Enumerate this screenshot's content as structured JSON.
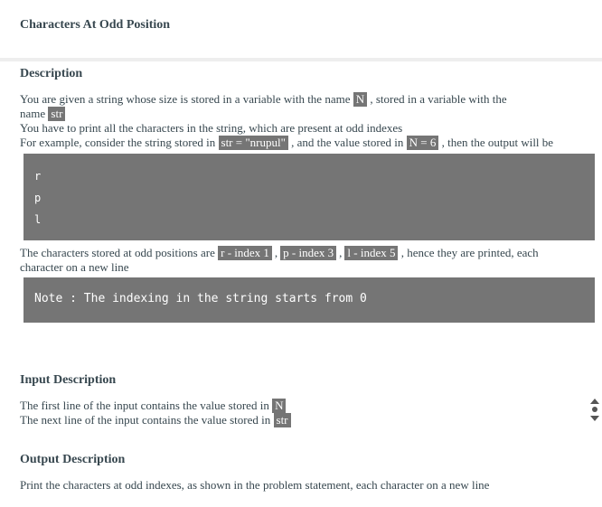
{
  "title": "Characters At Odd Position",
  "description": {
    "heading": "Description",
    "line1_a": "You are given a string whose size is stored in a variable with the name",
    "line1_chip": "N",
    "line1_b": ", stored in a variable with the",
    "line2_a": "name",
    "line2_chip": "str",
    "line3": "You have to print all the characters in the string, which are present at odd indexes",
    "line4_a": "For example, consider the string stored in",
    "line4_chip1": "str = \"nrupul\"",
    "line4_b": ", and the value stored in",
    "line4_chip2": "N = 6",
    "line4_c": ", then the output will be",
    "code_lines": [
      "r",
      "p",
      "l"
    ],
    "line5_a": "The characters stored at odd positions are",
    "line5_chip1": "r - index 1",
    "line5_chip2": "p - index 3",
    "line5_chip3": "l - index 5",
    "line5_b": ", hence they are printed, each",
    "line6": "character on a new line",
    "note": "Note : The indexing in the string starts from 0"
  },
  "input": {
    "heading": "Input Description",
    "line1_a": "The first line of the input contains the value stored in",
    "line1_chip": "N",
    "line2_a": "The next line of the input contains the value stored in",
    "line2_chip": "str"
  },
  "output": {
    "heading": "Output Description",
    "line1": "Print the characters at odd indexes, as shown in the problem statement, each character on a new line"
  },
  "scroll_icon": "scroll-updown-icon"
}
